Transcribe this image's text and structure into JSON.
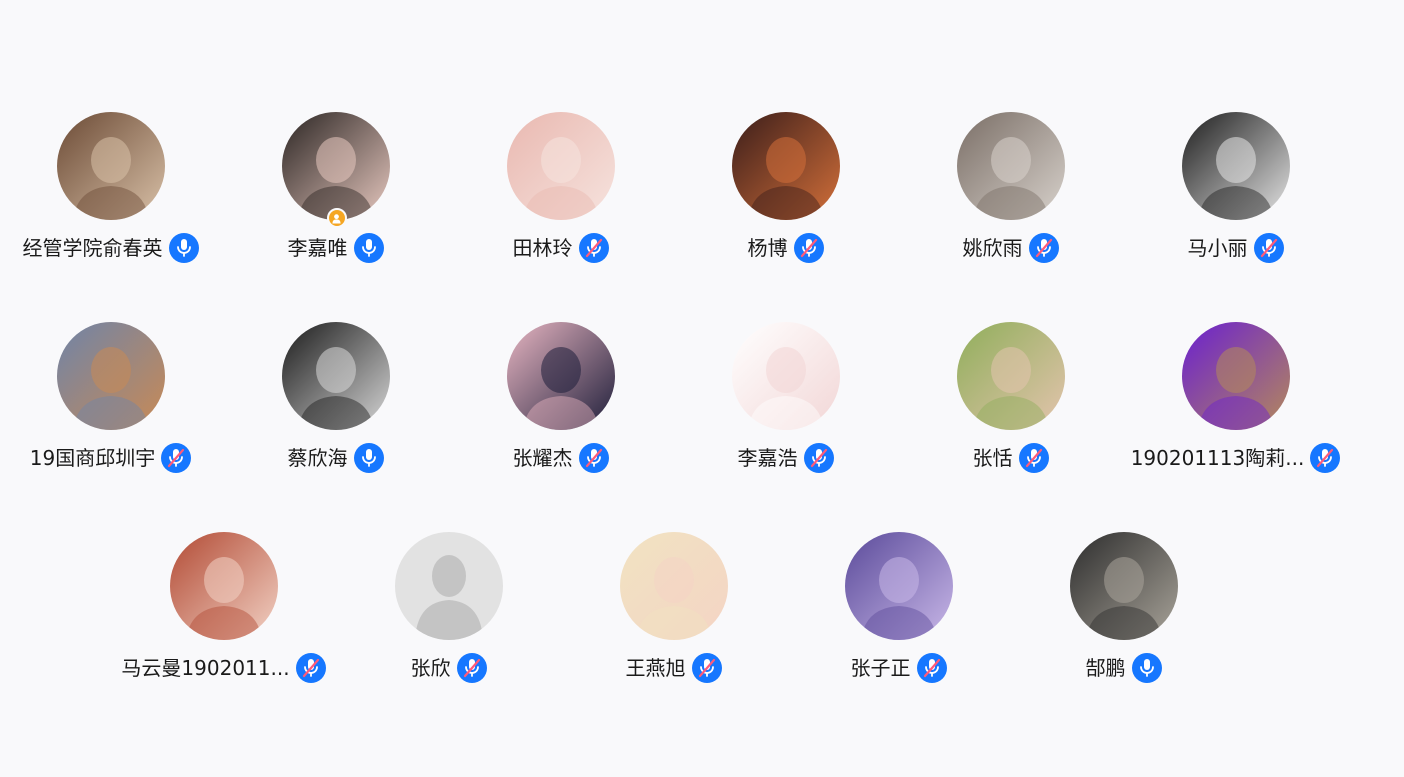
{
  "colors": {
    "background": "#f9f9fb",
    "mic_blue": "#1677ff",
    "mute_slash": "#ff5a7a",
    "host_badge": "#f5a623",
    "name_text": "#1a1a1a"
  },
  "participants": [
    {
      "name": "经管学院俞春英",
      "mic": "on",
      "host": false,
      "avatar_icon": "cat-photo-avatar",
      "bg": [
        "#6b4a35",
        "#d9c1a8"
      ]
    },
    {
      "name": "李嘉唯",
      "mic": "on",
      "host": true,
      "avatar_icon": "girl-selfie-avatar",
      "bg": [
        "#2a2422",
        "#e8c9c0"
      ]
    },
    {
      "name": "田林玲",
      "mic": "muted",
      "host": false,
      "avatar_icon": "baby-face-avatar",
      "bg": [
        "#e9b8b0",
        "#f6e3de"
      ]
    },
    {
      "name": "杨博",
      "mic": "muted",
      "host": false,
      "avatar_icon": "sunset-silhouette-avatar",
      "bg": [
        "#3a1d1a",
        "#d4703a"
      ]
    },
    {
      "name": "姚欣雨",
      "mic": "muted",
      "host": false,
      "avatar_icon": "mirror-selfie-avatar",
      "bg": [
        "#7a6e66",
        "#d8d2cc"
      ]
    },
    {
      "name": "马小丽",
      "mic": "muted",
      "host": false,
      "avatar_icon": "manga-girl-avatar",
      "bg": [
        "#1c1c1c",
        "#e6e6e6"
      ]
    },
    {
      "name": "19国商邱圳宇",
      "mic": "muted",
      "host": false,
      "avatar_icon": "cartoon-man-mask-avatar",
      "bg": [
        "#6f84a8",
        "#c98a55"
      ]
    },
    {
      "name": "蔡欣海",
      "mic": "on",
      "host": false,
      "avatar_icon": "man-bw-photo-avatar",
      "bg": [
        "#1a1a1a",
        "#d8d8d8"
      ]
    },
    {
      "name": "张耀杰",
      "mic": "muted",
      "host": false,
      "avatar_icon": "black-cat-cartoon-avatar",
      "bg": [
        "#e8b6c2",
        "#1e1e3a"
      ]
    },
    {
      "name": "李嘉浩",
      "mic": "muted",
      "host": false,
      "avatar_icon": "doodle-hearts-avatar",
      "bg": [
        "#ffffff",
        "#f2d6d6"
      ]
    },
    {
      "name": "张恬",
      "mic": "muted",
      "host": false,
      "avatar_icon": "toddler-photo-avatar",
      "bg": [
        "#8fae5a",
        "#e4c4ae"
      ]
    },
    {
      "name": "190201113陶莉...",
      "mic": "muted",
      "host": false,
      "avatar_icon": "anime-boy-purple-avatar",
      "bg": [
        "#6a1fd1",
        "#b58a5a"
      ]
    },
    {
      "name": "马云曼1902011...",
      "mic": "muted",
      "host": false,
      "avatar_icon": "anime-girl-hearts-avatar",
      "bg": [
        "#b24a34",
        "#f2d2c5"
      ]
    },
    {
      "name": "张欣",
      "mic": "muted",
      "host": false,
      "avatar_icon": "default-person-avatar",
      "bg": [
        "#e3e3e3",
        "#c7c7c7"
      ]
    },
    {
      "name": "王燕旭",
      "mic": "muted",
      "host": false,
      "avatar_icon": "child-bear-hat-avatar",
      "bg": [
        "#f1e3c2",
        "#f4d4c4"
      ]
    },
    {
      "name": "张子正",
      "mic": "muted",
      "host": false,
      "avatar_icon": "anime-boy-night-avatar",
      "bg": [
        "#5a4a9a",
        "#c9b8e8"
      ]
    },
    {
      "name": "郜鹏",
      "mic": "on",
      "host": false,
      "avatar_icon": "suit-flowers-avatar",
      "bg": [
        "#2c2c2c",
        "#a9a49a"
      ]
    }
  ]
}
